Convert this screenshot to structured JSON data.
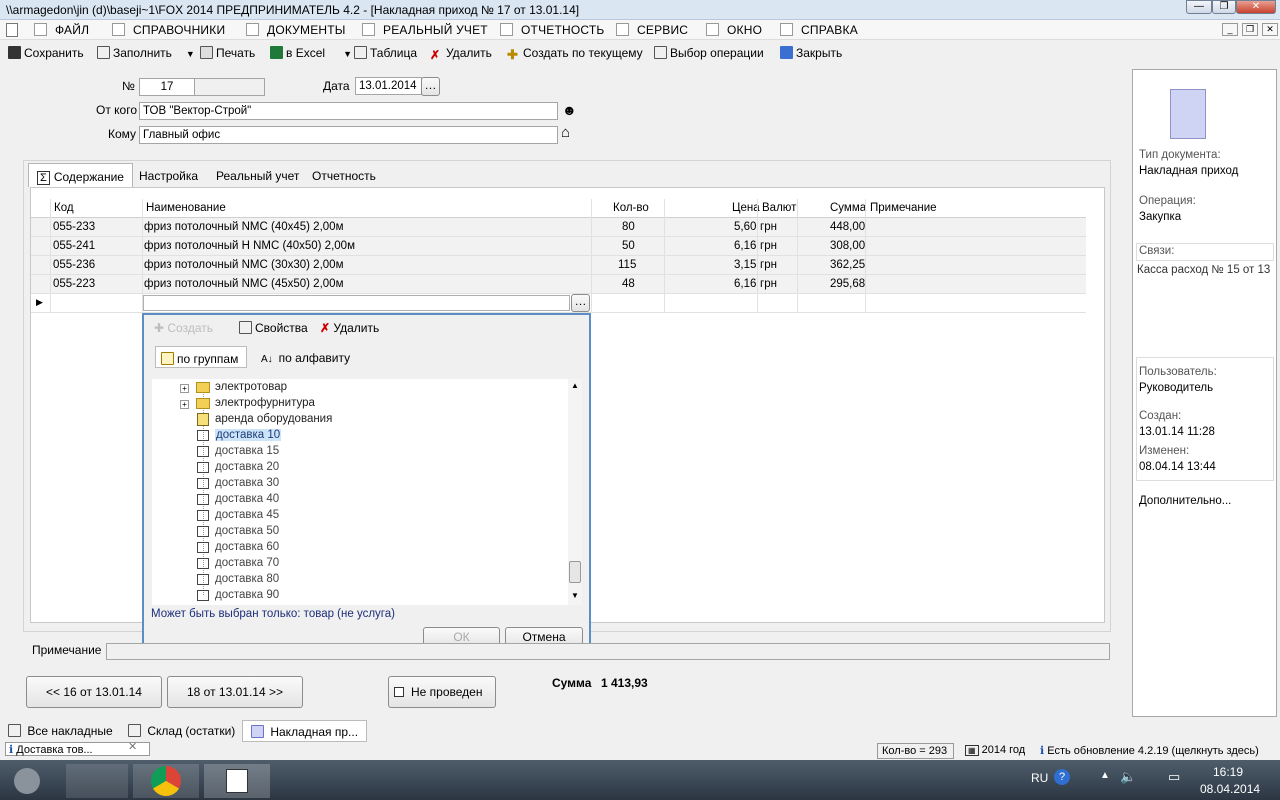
{
  "window": {
    "title": "\\\\armagedon\\jin (d)\\baseji~1\\FOX 2014  ПРЕДПРИНИМАТЕЛЬ 4.2 - [Накладная приход № 17 от 13.01.14]"
  },
  "menu": [
    "ФАЙЛ",
    "СПРАВОЧНИКИ",
    "ДОКУМЕНТЫ",
    "РЕАЛЬНЫЙ УЧЕТ",
    "ОТЧЕТНОСТЬ",
    "СЕРВИС",
    "ОКНО",
    "СПРАВКА"
  ],
  "toolbar": {
    "save": "Сохранить",
    "fill": "Заполнить",
    "print": "Печать",
    "excel": "в Excel",
    "table": "Таблица",
    "delete": "Удалить",
    "create_current": "Создать по текущему",
    "choose_op": "Выбор операции",
    "close": "Закрыть"
  },
  "doc": {
    "num_label": "№",
    "num": "17",
    "date_label": "Дата",
    "date": "13.01.2014",
    "from_label": "От кого",
    "from": "ТОВ \"Вектор-Строй\"",
    "to_label": "Кому",
    "to": "Главный офис"
  },
  "tabs": [
    "Содержание",
    "Настройка",
    "Реальный учет",
    "Отчетность"
  ],
  "grid": {
    "headers": {
      "code": "Код",
      "name": "Наименование",
      "qty": "Кол-во",
      "price": "Цена",
      "cur": "Валют",
      "sum": "Сумма",
      "note": "Примечание"
    },
    "rows": [
      {
        "code": "055-233",
        "name": "фриз потолочный NMC (40х45) 2,00м",
        "qty": "80",
        "price": "5,60",
        "cur": "грн",
        "sum": "448,00"
      },
      {
        "code": "055-241",
        "name": "фриз потолочный H NMC (40х50) 2,00м",
        "qty": "50",
        "price": "6,16",
        "cur": "грн",
        "sum": "308,00"
      },
      {
        "code": "055-236",
        "name": "фриз потолочный NMC (30х30) 2,00м",
        "qty": "115",
        "price": "3,15",
        "cur": "грн",
        "sum": "362,25"
      },
      {
        "code": "055-223",
        "name": "фриз потолочный NMC (45х50) 2,00м",
        "qty": "48",
        "price": "6,16",
        "cur": "грн",
        "sum": "295,68"
      }
    ]
  },
  "popup": {
    "create": "Создать",
    "props": "Свойства",
    "delete": "Удалить",
    "by_groups": "по группам",
    "by_alpha": "по алфавиту",
    "tree": [
      "электротовар",
      "электрофурнитура",
      "аренда оборудования",
      "доставка 10",
      "доставка 15",
      "доставка 20",
      "доставка 30",
      "доставка 40",
      "доставка 45",
      "доставка 50",
      "доставка 60",
      "доставка 70",
      "доставка 80",
      "доставка 90"
    ],
    "hint": "Может быть выбран только: товар (не услуга)",
    "ok": "ОК",
    "cancel": "Отмена"
  },
  "note_label": "Примечание",
  "nav": {
    "prev": "<< 16 от 13.01.14",
    "next": "18 от 13.01.14 >>",
    "not_posted": "Не проведен",
    "sum_label": "Сумма",
    "sum": "1 413,93"
  },
  "side": {
    "type_label": "Тип документа:",
    "type": "Накладная приход",
    "op_label": "Операция:",
    "op": "Закупка",
    "links_label": "Связи:",
    "link": "Касса расход № 15 от 13",
    "user_label": "Пользователь:",
    "user": "Руководитель",
    "created_label": "Создан:",
    "created": "13.01.14  11:28",
    "changed_label": "Изменен:",
    "changed": "08.04.14  13:44",
    "more": "Дополнительно..."
  },
  "wintabs": [
    "Все накладные",
    "Склад (остатки)",
    "Накладная пр..."
  ],
  "status": {
    "tip": "Доставка тов...",
    "qty": "Кол-во = 293",
    "year": "2014 год",
    "update": "Есть обновление 4.2.19  (щелкнуть здесь)"
  },
  "tray": {
    "lang": "RU",
    "time": "16:19",
    "date": "08.04.2014"
  },
  "colors": {
    "accent": "#5b8ec4",
    "selection": "#cde3f7"
  }
}
